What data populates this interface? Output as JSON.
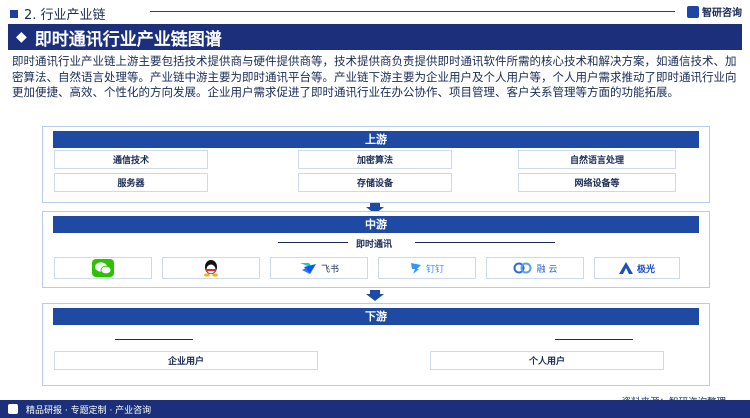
{
  "header": {
    "section": "2. 行业产业链",
    "brand": "智研咨询"
  },
  "title": "即时通讯行业产业链图谱",
  "description": "即时通讯行业产业链上游主要包括技术提供商与硬件提供商等，技术提供商负责提供即时通讯软件所需的核心技术和解决方案，如通信技术、加密算法、自然语言处理等。产业链中游主要为即时通讯平台等。产业链下游主要为企业用户及个人用户等，个人用户需求推动了即时通讯行业向更加便捷、高效、个性化的方向发展。企业用户需求促进了即时通讯行业在办公协作、项目管理、客户关系管理等方面的功能拓展。",
  "upstream": {
    "label": "上游",
    "items": [
      "通信技术",
      "加密算法",
      "自然语言处理",
      "服务器",
      "存储设备",
      "网络设备等"
    ]
  },
  "midstream": {
    "label": "中游",
    "sublabel": "即时通讯",
    "apps": [
      {
        "icon": "wechat-icon",
        "text": ""
      },
      {
        "icon": "qq-icon",
        "text": ""
      },
      {
        "icon": "feishu-icon",
        "text": "飞书"
      },
      {
        "icon": "dingtalk-icon",
        "text": "钉钉"
      },
      {
        "icon": "rongyun-icon",
        "text": "融 云"
      },
      {
        "icon": "jiguang-icon",
        "text": "极光"
      }
    ]
  },
  "downstream": {
    "label": "下游",
    "items": [
      "企业用户",
      "个人用户"
    ]
  },
  "source": "资料来源：智研咨询整理",
  "footer": "精品研报 · 专题定制 · 产业咨询",
  "colors": {
    "navy": "#1b2f7a",
    "blue": "#1e4aa3",
    "wechat": "#2dc100",
    "qq": "#111111",
    "feishu": "#1456f0",
    "dingtalk": "#3296fa",
    "rongyun": "#2f6bd8",
    "jiguang": "#1e4fc2"
  }
}
